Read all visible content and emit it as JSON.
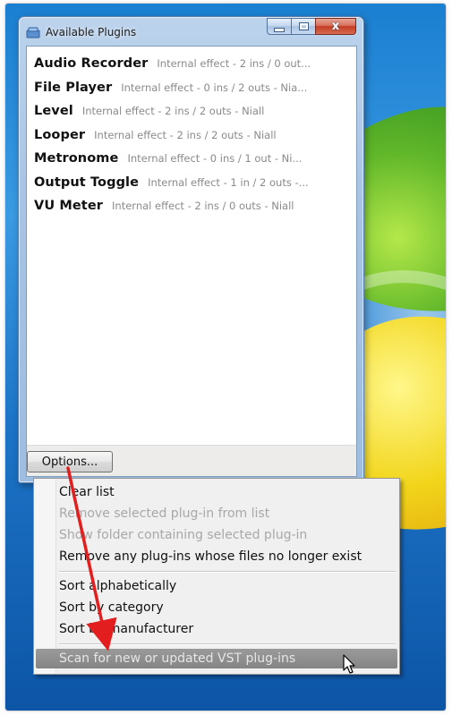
{
  "window": {
    "title": "Available Plugins",
    "caption_glyphs": {
      "minimize": "–",
      "maximize": "□",
      "close": "x"
    }
  },
  "plugins": [
    {
      "name": "Audio Recorder",
      "description": "Internal effect - 2 ins / 0 out..."
    },
    {
      "name": "File Player",
      "description": "Internal effect - 0 ins / 2 outs - Nia..."
    },
    {
      "name": "Level",
      "description": "Internal effect - 2 ins / 2 outs - Niall"
    },
    {
      "name": "Looper",
      "description": "Internal effect - 2 ins / 2 outs - Niall"
    },
    {
      "name": "Metronome",
      "description": "Internal effect - 0 ins / 1 out - Ni..."
    },
    {
      "name": "Output Toggle",
      "description": "Internal effect - 1 in / 2 outs -..."
    },
    {
      "name": "VU Meter",
      "description": "Internal effect - 2 ins / 0 outs - Niall"
    }
  ],
  "options_button": {
    "label": "Options..."
  },
  "menu": {
    "groups": [
      [
        {
          "label": "Clear list",
          "enabled": true
        },
        {
          "label": "Remove selected plug-in from list",
          "enabled": false
        },
        {
          "label": "Show folder containing selected plug-in",
          "enabled": false
        },
        {
          "label": "Remove any plug-ins whose files no longer exist",
          "enabled": true
        }
      ],
      [
        {
          "label": "Sort alphabetically",
          "enabled": true
        },
        {
          "label": "Sort by category",
          "enabled": true
        },
        {
          "label": "Sort by manufacturer",
          "enabled": true
        }
      ],
      [
        {
          "label": "Scan for new or updated VST plug-ins",
          "enabled": true,
          "highlighted": true
        }
      ]
    ]
  },
  "colors": {
    "annotation_arrow": "#e21e1e",
    "menu_highlight": "#8c8c8c",
    "disabled_text": "#a8a8a8"
  }
}
